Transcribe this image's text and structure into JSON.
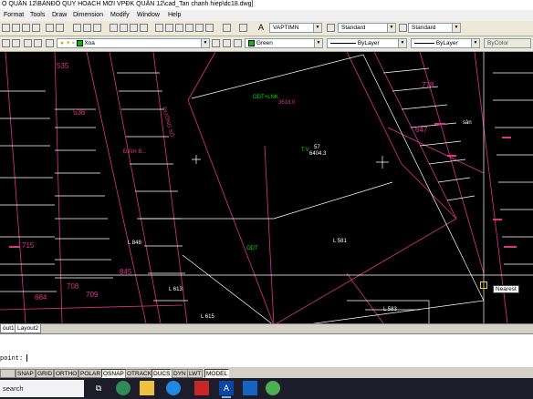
{
  "window": {
    "title": "Ộ QUẬN 12\\BẢNĐỒ QUY HOẠCH MỚI VPĐK QUẬN 12\\cad_Tan chanh hiep\\dc18.dwg]"
  },
  "menu": [
    "Format",
    "Tools",
    "Draw",
    "Dimension",
    "Modify",
    "Window",
    "Help"
  ],
  "toolbar1": {
    "text_style": "VAPTIMN",
    "dim_style": "Standard",
    "table_style": "Standard"
  },
  "toolbar2": {
    "layer": "Xoa",
    "color": "Green",
    "linetype": "ByLayer",
    "lineweight": "ByLayer",
    "plotstyle": "ByColor"
  },
  "drawing": {
    "labels": [
      {
        "t": "535",
        "c": "#e0338a"
      },
      {
        "t": "536",
        "c": "#e0338a"
      },
      {
        "t": "ĐINH B...",
        "c": "#e0338a"
      },
      {
        "t": "845",
        "c": "#e0338a"
      },
      {
        "t": "709",
        "c": "#e0338a"
      },
      {
        "t": "708",
        "c": "#e0338a"
      },
      {
        "t": "684",
        "c": "#e0338a"
      },
      {
        "t": "715",
        "c": "#e0338a"
      },
      {
        "t": "778",
        "c": "#e0338a"
      },
      {
        "t": "647",
        "c": "#e0338a"
      },
      {
        "t": "ODT",
        "c": "#00e000"
      },
      {
        "t": "ODT+LNK",
        "c": "#00e000"
      },
      {
        "t": "T.V",
        "c": "#00e000"
      },
      {
        "t": "57",
        "c": "#ffffff"
      },
      {
        "t": "6404.3",
        "c": "#ffffff"
      },
      {
        "t": "3618.0",
        "c": "#e0338a"
      },
      {
        "t": "L 581",
        "c": "#ffffff"
      },
      {
        "t": "L 583",
        "c": "#ffffff"
      },
      {
        "t": "L 615",
        "c": "#ffffff"
      },
      {
        "t": "L 613",
        "c": "#ffffff"
      },
      {
        "t": "L 848",
        "c": "#ffffff"
      },
      {
        "t": "ĐƯỜNG SỐ",
        "c": "#e0338a"
      },
      {
        "t": "sân",
        "c": "#ffffff"
      },
      {
        "t": "Nearest",
        "c": "#000"
      }
    ]
  },
  "layout_tabs": [
    "ȯut1",
    "Layout2"
  ],
  "command": {
    "prompt": "point:"
  },
  "status": [
    {
      "label": "SNAP",
      "on": false
    },
    {
      "label": "GRID",
      "on": false
    },
    {
      "label": "ORTHO",
      "on": false
    },
    {
      "label": "POLAR",
      "on": false
    },
    {
      "label": "OSNAP",
      "on": true
    },
    {
      "label": "OTRACK",
      "on": false
    },
    {
      "label": "DUCS",
      "on": true
    },
    {
      "label": "DYN",
      "on": false
    },
    {
      "label": "LWT",
      "on": false
    },
    {
      "label": "MODEL",
      "on": true
    }
  ],
  "taskbar": {
    "search": "search"
  }
}
